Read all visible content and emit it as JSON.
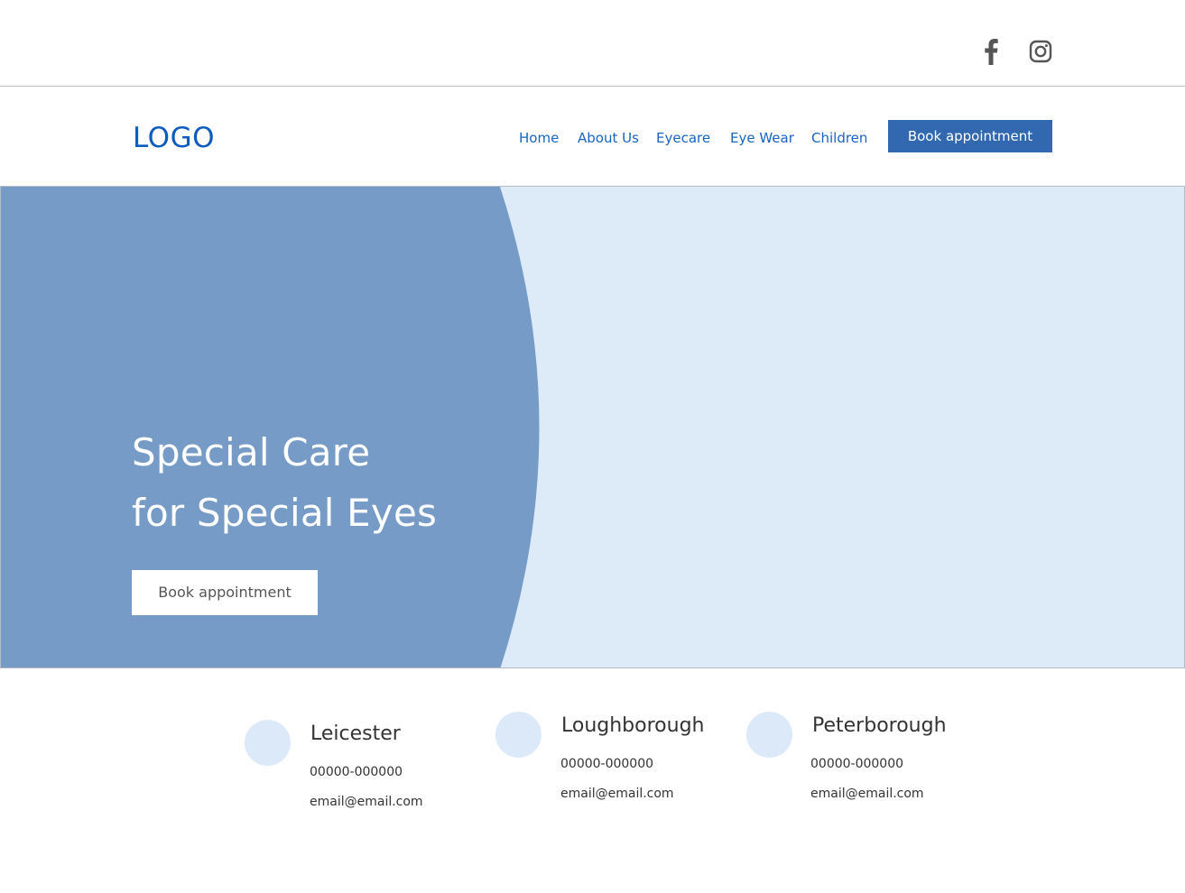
{
  "colors": {
    "brand_blue": "#0d5bbf",
    "nav_blue": "#1764c1",
    "button_blue": "#3168b0",
    "hero_dark": "#769bc7",
    "hero_light": "#ddebf8",
    "location_circle": "#dce9f8"
  },
  "social": {
    "facebook_icon": "facebook-icon",
    "instagram_icon": "instagram-icon"
  },
  "header": {
    "logo": "LOGO",
    "nav": [
      "Home",
      "About Us",
      "Eyecare",
      "Eye Wear",
      "Children"
    ],
    "cta": "Book appointment"
  },
  "hero": {
    "title_line1": "Special Care",
    "title_line2": "for Special Eyes",
    "cta": "Book appointment"
  },
  "locations": [
    {
      "city": "Leicester",
      "phone": "00000-000000",
      "email": "email@email.com"
    },
    {
      "city": "Loughborough",
      "phone": "00000-000000",
      "email": "email@email.com"
    },
    {
      "city": "Peterborough",
      "phone": "00000-000000",
      "email": "email@email.com"
    }
  ]
}
